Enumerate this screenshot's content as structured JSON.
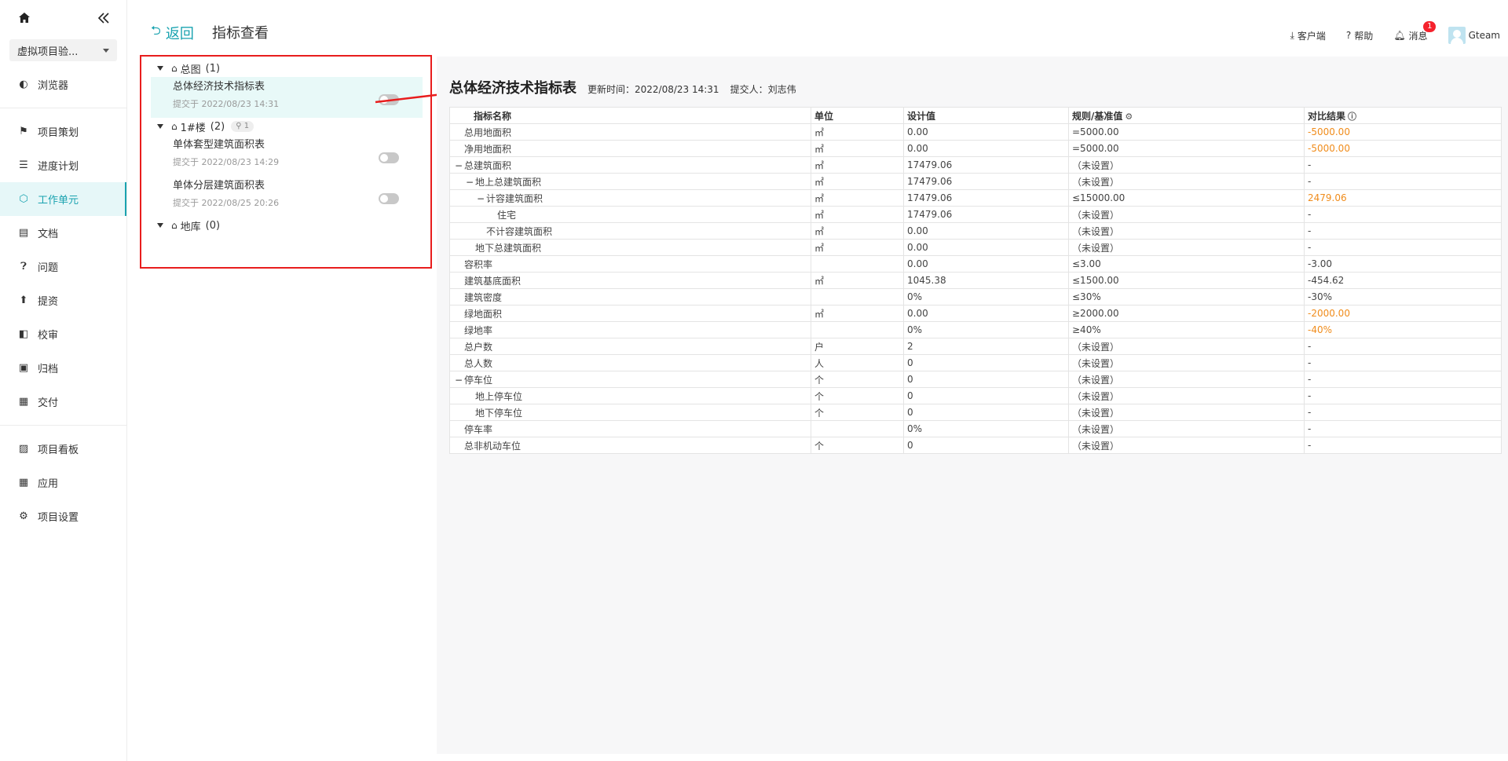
{
  "sidebar": {
    "project_name": "虚拟项目验...",
    "items_top": [
      {
        "label": "浏览器",
        "icon": "globe-icon"
      }
    ],
    "items_main": [
      {
        "label": "项目策划",
        "icon": "flag-icon",
        "active": false
      },
      {
        "label": "进度计划",
        "icon": "gantt-icon",
        "active": false
      },
      {
        "label": "工作单元",
        "icon": "cube-icon",
        "active": true
      },
      {
        "label": "文档",
        "icon": "document-icon",
        "active": false
      },
      {
        "label": "问题",
        "icon": "question-icon",
        "active": false
      },
      {
        "label": "提资",
        "icon": "upload-icon",
        "active": false
      },
      {
        "label": "校审",
        "icon": "review-icon",
        "active": false
      },
      {
        "label": "归档",
        "icon": "archive-icon",
        "active": false
      },
      {
        "label": "交付",
        "icon": "briefcase-icon",
        "active": false
      }
    ],
    "items_bottom": [
      {
        "label": "项目看板",
        "icon": "dashboard-icon"
      },
      {
        "label": "应用",
        "icon": "apps-icon"
      },
      {
        "label": "项目设置",
        "icon": "gear-icon"
      }
    ]
  },
  "header": {
    "back_label": "返回",
    "title": "指标查看",
    "client_label": "客户端",
    "help_label": "帮助",
    "messages_label": "消息",
    "messages_badge": "1",
    "user_name": "Gteam"
  },
  "tree": {
    "groups": [
      {
        "label": "总图",
        "count": "(1)",
        "icon": "building-icon",
        "chip": "",
        "children": [
          {
            "title": "总体经济技术指标表",
            "sub": "提交于 2022/08/23 14:31",
            "selected": true
          }
        ]
      },
      {
        "label": "1#楼",
        "count": "(2)",
        "icon": "house-icon",
        "chip": "1",
        "children": [
          {
            "title": "单体套型建筑面积表",
            "sub": "提交于 2022/08/23 14:29",
            "selected": false
          },
          {
            "title": "单体分层建筑面积表",
            "sub": "提交于 2022/08/25 20:26",
            "selected": false
          }
        ]
      },
      {
        "label": "地库",
        "count": "(0)",
        "icon": "house-icon",
        "chip": "",
        "children": []
      }
    ]
  },
  "table": {
    "title": "总体经济技术指标表",
    "updated": "更新时间：2022/08/23 14:31",
    "submitter": "提交人：刘志伟",
    "headers": [
      "指标名称",
      "单位",
      "设计值",
      "规则/基准值",
      "对比结果"
    ],
    "rows": [
      {
        "name": "总用地面积",
        "level": 0,
        "exp": "",
        "unit": "㎡",
        "design": "0.00",
        "rule": "=5000.00",
        "result": "-5000.00",
        "warn": true
      },
      {
        "name": "净用地面积",
        "level": 0,
        "exp": "",
        "unit": "㎡",
        "design": "0.00",
        "rule": "=5000.00",
        "result": "-5000.00",
        "warn": true
      },
      {
        "name": "总建筑面积",
        "level": 0,
        "exp": "−",
        "unit": "㎡",
        "design": "17479.06",
        "rule": "（未设置）",
        "result": "-",
        "warn": false
      },
      {
        "name": "地上总建筑面积",
        "level": 1,
        "exp": "−",
        "unit": "㎡",
        "design": "17479.06",
        "rule": "（未设置）",
        "result": "-",
        "warn": false
      },
      {
        "name": "计容建筑面积",
        "level": 2,
        "exp": "−",
        "unit": "㎡",
        "design": "17479.06",
        "rule": "≤15000.00",
        "result": "2479.06",
        "warn": true
      },
      {
        "name": "住宅",
        "level": 3,
        "exp": "",
        "unit": "㎡",
        "design": "17479.06",
        "rule": "（未设置）",
        "result": "-",
        "warn": false
      },
      {
        "name": "不计容建筑面积",
        "level": 2,
        "exp": "",
        "unit": "㎡",
        "design": "0.00",
        "rule": "（未设置）",
        "result": "-",
        "warn": false
      },
      {
        "name": "地下总建筑面积",
        "level": 1,
        "exp": "",
        "unit": "㎡",
        "design": "0.00",
        "rule": "（未设置）",
        "result": "-",
        "warn": false
      },
      {
        "name": "容积率",
        "level": 0,
        "exp": "",
        "unit": "",
        "design": "0.00",
        "rule": "≤3.00",
        "result": "-3.00",
        "warn": false
      },
      {
        "name": "建筑基底面积",
        "level": 0,
        "exp": "",
        "unit": "㎡",
        "design": "1045.38",
        "rule": "≤1500.00",
        "result": "-454.62",
        "warn": false
      },
      {
        "name": "建筑密度",
        "level": 0,
        "exp": "",
        "unit": "",
        "design": "0%",
        "rule": "≤30%",
        "result": "-30%",
        "warn": false
      },
      {
        "name": "绿地面积",
        "level": 0,
        "exp": "",
        "unit": "㎡",
        "design": "0.00",
        "rule": "≥2000.00",
        "result": "-2000.00",
        "warn": true
      },
      {
        "name": "绿地率",
        "level": 0,
        "exp": "",
        "unit": "",
        "design": "0%",
        "rule": "≥40%",
        "result": "-40%",
        "warn": true
      },
      {
        "name": "总户数",
        "level": 0,
        "exp": "",
        "unit": "户",
        "design": "2",
        "rule": "（未设置）",
        "result": "-",
        "warn": false
      },
      {
        "name": "总人数",
        "level": 0,
        "exp": "",
        "unit": "人",
        "design": "0",
        "rule": "（未设置）",
        "result": "-",
        "warn": false
      },
      {
        "name": "停车位",
        "level": 0,
        "exp": "−",
        "unit": "个",
        "design": "0",
        "rule": "（未设置）",
        "result": "-",
        "warn": false
      },
      {
        "name": "地上停车位",
        "level": 1,
        "exp": "",
        "unit": "个",
        "design": "0",
        "rule": "（未设置）",
        "result": "-",
        "warn": false
      },
      {
        "name": "地下停车位",
        "level": 1,
        "exp": "",
        "unit": "个",
        "design": "0",
        "rule": "（未设置）",
        "result": "-",
        "warn": false
      },
      {
        "name": "停车率",
        "level": 0,
        "exp": "",
        "unit": "",
        "design": "0%",
        "rule": "（未设置）",
        "result": "-",
        "warn": false
      },
      {
        "name": "总非机动车位",
        "level": 0,
        "exp": "",
        "unit": "个",
        "design": "0",
        "rule": "（未设置）",
        "result": "-",
        "warn": false
      }
    ]
  },
  "colors": {
    "accent": "#1aa3b0",
    "warning": "#f08c1b",
    "annotation": "#e81d1d"
  }
}
